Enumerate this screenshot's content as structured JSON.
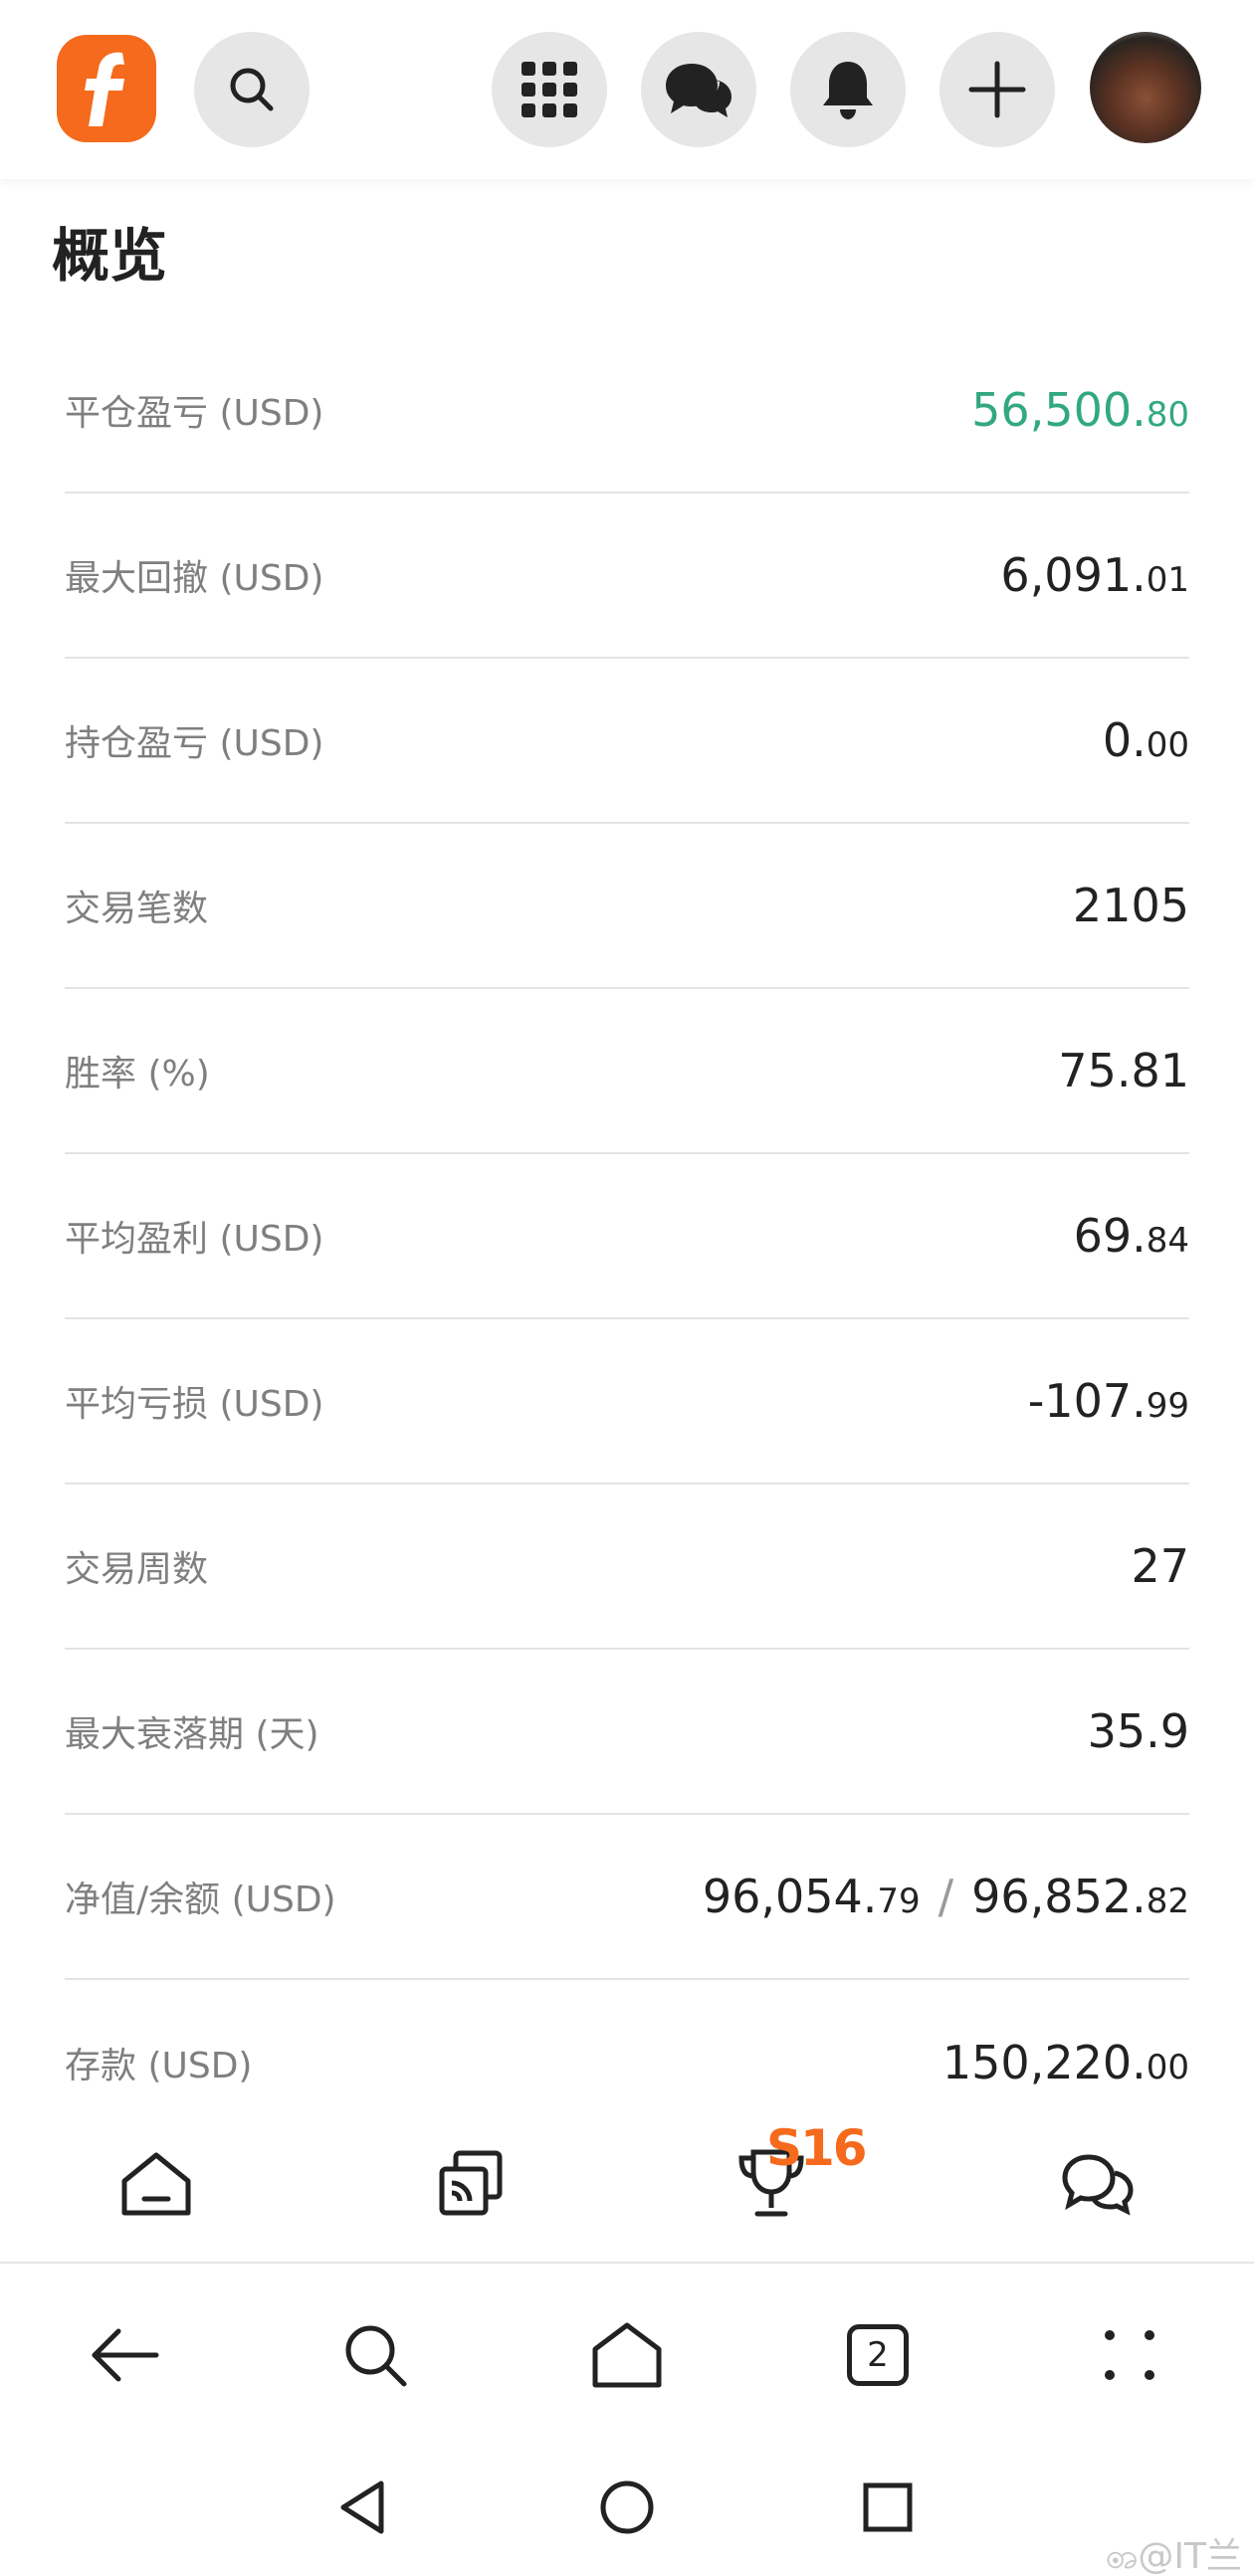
{
  "header": {
    "icons": [
      "app-logo",
      "search-icon",
      "apps-grid-icon",
      "chat-bubbles-icon",
      "bell-icon",
      "plus-icon",
      "avatar"
    ]
  },
  "overview": {
    "title": "概览",
    "rows": [
      {
        "label": "平仓盈亏 (USD)",
        "main": "56,500.",
        "small": "80",
        "color": "#32a882"
      },
      {
        "label": "最大回撤 (USD)",
        "main": "6,091.",
        "small": "01"
      },
      {
        "label": "持仓盈亏 (USD)",
        "main": "0.",
        "small": "00"
      },
      {
        "label": "交易笔数",
        "main": "2105",
        "small": ""
      },
      {
        "label": "胜率 (%)",
        "main": "75.81",
        "small": ""
      },
      {
        "label": "平均盈利 (USD)",
        "main": "69.",
        "small": "84"
      },
      {
        "label": "平均亏损 (USD)",
        "main": "-107.",
        "small": "99"
      },
      {
        "label": "交易周数",
        "main": "27",
        "small": ""
      },
      {
        "label": "最大衰落期 (天)",
        "main": "35.9",
        "small": ""
      },
      {
        "label": "净值/余额 (USD)",
        "main": "96,054.",
        "small": "79",
        "sep": "/",
        "main2": "96,852.",
        "small2": "82"
      },
      {
        "label": "存款 (USD)",
        "main": "150,220.",
        "small": "00"
      }
    ]
  },
  "site_nav": {
    "badge": "S16",
    "items": [
      "home-icon",
      "copy-trading-icon",
      "trophy-icon",
      "chat-icon"
    ]
  },
  "browser_bar": {
    "tab_count": "2",
    "items": [
      "back-arrow-icon",
      "search-icon",
      "home-icon",
      "tabs-icon",
      "more-icon"
    ]
  },
  "system_nav": {
    "items": [
      "back-triangle-icon",
      "home-circle-icon",
      "recents-square-icon"
    ]
  },
  "watermark": "ꩨ@IT兰"
}
